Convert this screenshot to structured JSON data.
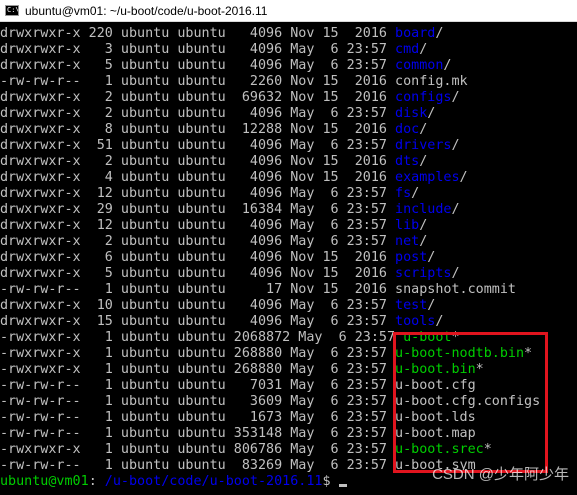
{
  "window": {
    "title": "ubuntu@vm01: ~/u-boot/code/u-boot-2016.11",
    "icon": "terminal-icon"
  },
  "listing": [
    {
      "meta": "drwxrwxr-x 220 ubuntu ubuntu   4096 Nov 15  2016 ",
      "name": "board",
      "kind": "dir",
      "suffix": "/"
    },
    {
      "meta": "drwxrwxr-x   3 ubuntu ubuntu   4096 May  6 23:57 ",
      "name": "cmd",
      "kind": "dir",
      "suffix": "/"
    },
    {
      "meta": "drwxrwxr-x   5 ubuntu ubuntu   4096 May  6 23:57 ",
      "name": "common",
      "kind": "dir",
      "suffix": "/"
    },
    {
      "meta": "-rw-rw-r--   1 ubuntu ubuntu   2260 Nov 15  2016 ",
      "name": "config.mk",
      "kind": "file",
      "suffix": ""
    },
    {
      "meta": "drwxrwxr-x   2 ubuntu ubuntu  69632 Nov 15  2016 ",
      "name": "configs",
      "kind": "dir",
      "suffix": "/"
    },
    {
      "meta": "drwxrwxr-x   2 ubuntu ubuntu   4096 May  6 23:57 ",
      "name": "disk",
      "kind": "dir",
      "suffix": "/"
    },
    {
      "meta": "drwxrwxr-x   8 ubuntu ubuntu  12288 Nov 15  2016 ",
      "name": "doc",
      "kind": "dir",
      "suffix": "/"
    },
    {
      "meta": "drwxrwxr-x  51 ubuntu ubuntu   4096 May  6 23:57 ",
      "name": "drivers",
      "kind": "dir",
      "suffix": "/"
    },
    {
      "meta": "drwxrwxr-x   2 ubuntu ubuntu   4096 Nov 15  2016 ",
      "name": "dts",
      "kind": "dir",
      "suffix": "/"
    },
    {
      "meta": "drwxrwxr-x   4 ubuntu ubuntu   4096 Nov 15  2016 ",
      "name": "examples",
      "kind": "dir",
      "suffix": "/"
    },
    {
      "meta": "drwxrwxr-x  12 ubuntu ubuntu   4096 May  6 23:57 ",
      "name": "fs",
      "kind": "dir",
      "suffix": "/"
    },
    {
      "meta": "drwxrwxr-x  29 ubuntu ubuntu  16384 May  6 23:57 ",
      "name": "include",
      "kind": "dir",
      "suffix": "/"
    },
    {
      "meta": "drwxrwxr-x  12 ubuntu ubuntu   4096 May  6 23:57 ",
      "name": "lib",
      "kind": "dir",
      "suffix": "/"
    },
    {
      "meta": "drwxrwxr-x   2 ubuntu ubuntu   4096 May  6 23:57 ",
      "name": "net",
      "kind": "dir",
      "suffix": "/"
    },
    {
      "meta": "drwxrwxr-x   6 ubuntu ubuntu   4096 Nov 15  2016 ",
      "name": "post",
      "kind": "dir",
      "suffix": "/"
    },
    {
      "meta": "drwxrwxr-x   5 ubuntu ubuntu   4096 Nov 15  2016 ",
      "name": "scripts",
      "kind": "dir",
      "suffix": "/"
    },
    {
      "meta": "-rw-rw-r--   1 ubuntu ubuntu     17 Nov 15  2016 ",
      "name": "snapshot.commit",
      "kind": "file",
      "suffix": ""
    },
    {
      "meta": "drwxrwxr-x  10 ubuntu ubuntu   4096 May  6 23:57 ",
      "name": "test",
      "kind": "dir",
      "suffix": "/"
    },
    {
      "meta": "drwxrwxr-x  15 ubuntu ubuntu   4096 May  6 23:57 ",
      "name": "tools",
      "kind": "dir",
      "suffix": "/"
    },
    {
      "meta": "-rwxrwxr-x   1 ubuntu ubuntu 2068872 May  6 23:57 ",
      "name": "u-boot",
      "kind": "exec",
      "suffix": "*"
    },
    {
      "meta": "-rwxrwxr-x   1 ubuntu ubuntu 268880 May  6 23:57 ",
      "name": "u-boot-nodtb.bin",
      "kind": "exec",
      "suffix": "*"
    },
    {
      "meta": "-rwxrwxr-x   1 ubuntu ubuntu 268880 May  6 23:57 ",
      "name": "u-boot.bin",
      "kind": "exec",
      "suffix": "*"
    },
    {
      "meta": "-rw-rw-r--   1 ubuntu ubuntu   7031 May  6 23:57 ",
      "name": "u-boot.cfg",
      "kind": "file",
      "suffix": ""
    },
    {
      "meta": "-rw-rw-r--   1 ubuntu ubuntu   3609 May  6 23:57 ",
      "name": "u-boot.cfg.configs",
      "kind": "file",
      "suffix": ""
    },
    {
      "meta": "-rw-rw-r--   1 ubuntu ubuntu   1673 May  6 23:57 ",
      "name": "u-boot.lds",
      "kind": "file",
      "suffix": ""
    },
    {
      "meta": "-rw-rw-r--   1 ubuntu ubuntu 353148 May  6 23:57 ",
      "name": "u-boot.map",
      "kind": "file",
      "suffix": ""
    },
    {
      "meta": "-rwxrwxr-x   1 ubuntu ubuntu 806786 May  6 23:57 ",
      "name": "u-boot.srec",
      "kind": "exec",
      "suffix": "*"
    },
    {
      "meta": "-rw-rw-r--   1 ubuntu ubuntu  83269 May  6 23:57 ",
      "name": "u-boot.sym",
      "kind": "file",
      "suffix": ""
    }
  ],
  "prompt": {
    "user": "ubuntu@vm01",
    "colon": ":",
    "path": " /u-boot/code/u-boot-2016.11",
    "dollar": "$"
  },
  "watermark": "CSDN @少年阿少年",
  "colors": {
    "directory": "#0000ee",
    "executable": "#00cd00",
    "text": "#c0c0c0",
    "highlight_box": "#e0141e"
  }
}
